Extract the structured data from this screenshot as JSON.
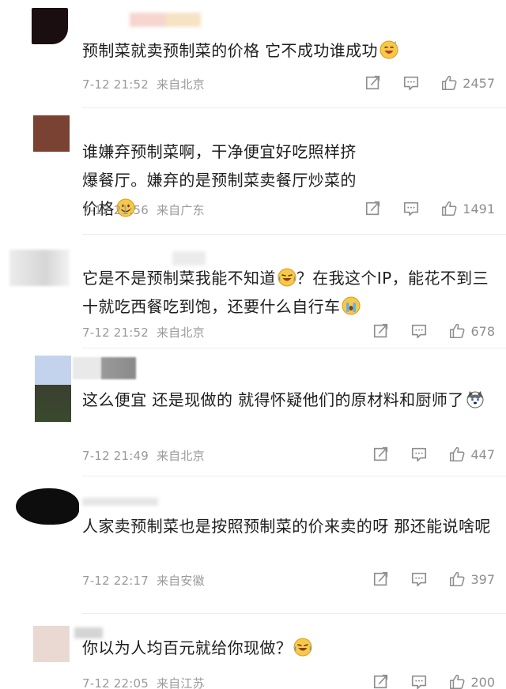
{
  "comments": [
    {
      "text": "预制菜就卖预制菜的价格 它不成功谁成功",
      "time": "7-12 21:52",
      "location": "来自北京",
      "likes": "2457"
    },
    {
      "text": "谁嫌弃预制菜啊，干净便宜好吃照样挤爆餐厅。嫌弃的是预制菜卖餐厅炒菜的价格",
      "time": "7-12 21:56",
      "location": "来自广东",
      "likes": "1491"
    },
    {
      "text1": "它是不是预制菜我能不知道",
      "text2": "？在我这个IP，能花不到三十就吃西餐吃到饱，还要什么自行车",
      "time": "7-12 21:52",
      "location": "来自北京",
      "likes": "678"
    },
    {
      "text": "这么便宜 还是现做的 就得怀疑他们的原材料和厨师了",
      "time": "7-12 21:49",
      "location": "来自北京",
      "likes": "447"
    },
    {
      "text": "人家卖预制菜也是按照预制菜的价来卖的呀 那还能说啥呢",
      "time": "7-12 22:17",
      "location": "来自安徽",
      "likes": "397"
    },
    {
      "text": "你以为人均百元就给你现做？",
      "time": "7-12 22:05",
      "location": "来自江苏",
      "likes": "200"
    }
  ],
  "icons": {
    "share": "share-icon",
    "reply": "comment-icon",
    "like": "thumbs-up-icon"
  }
}
